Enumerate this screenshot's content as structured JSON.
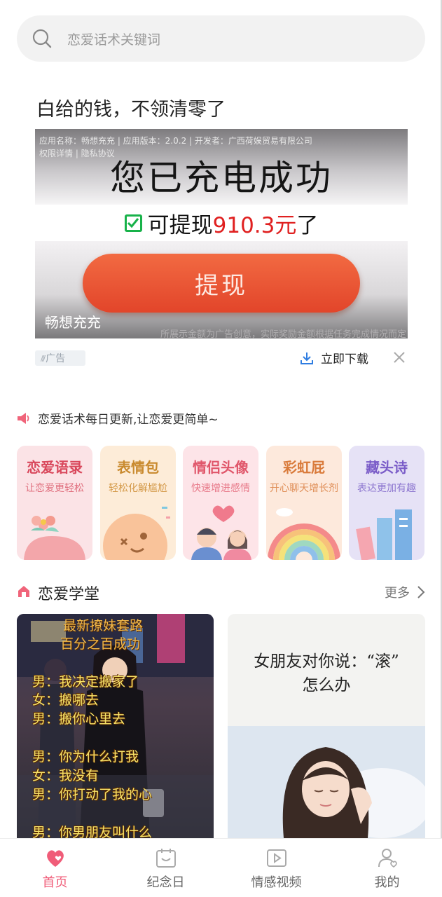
{
  "search": {
    "placeholder": "恋爱话术关键词"
  },
  "ad": {
    "title": "白给的钱，不领清零了",
    "meta_line1": "应用名称：畅想充充 | 应用版本：2.0.2 | 开发者：广西荷娱贸易有限公司",
    "meta_line2": "权限详情 | 隐私协议",
    "headline": "您已充电成功",
    "withdraw_prefix": "可提现",
    "withdraw_amount": "910.3元",
    "withdraw_suffix": "了",
    "button_label": "提现",
    "brand": "畅想充充",
    "disclaimer": "所展示金额为广告创意，实际奖励金额根据任务完成情况而定",
    "tag_label": "广告",
    "download_label": "立即下载"
  },
  "notice": {
    "text": "恋爱话术每日更新,让恋爱更简单~"
  },
  "categories": [
    {
      "title": "恋爱语录",
      "subtitle": "让恋爱更轻松",
      "bg": "#fbe3e6",
      "title_color": "#d9485c",
      "sub_color": "#e0707f"
    },
    {
      "title": "表情包",
      "subtitle": "轻松化解尴尬",
      "bg": "#fdecd8",
      "title_color": "#c98a2e",
      "sub_color": "#d49a4a"
    },
    {
      "title": "情侣头像",
      "subtitle": "快速增进感情",
      "bg": "#fde4e8",
      "title_color": "#e0566a",
      "sub_color": "#e87a8a"
    },
    {
      "title": "彩虹屁",
      "subtitle": "开心聊天增长剂",
      "bg": "#fde9dc",
      "title_color": "#d97a3a",
      "sub_color": "#e0905a"
    },
    {
      "title": "藏头诗",
      "subtitle": "表达更加有趣",
      "bg": "#e6e2f6",
      "title_color": "#7a5cc8",
      "sub_color": "#8e78d0"
    }
  ],
  "school": {
    "title": "恋爱学堂",
    "more_label": "更多"
  },
  "articles": {
    "left": {
      "heading1": "最新撩妹套路",
      "heading2": "百分之百成功",
      "lines": [
        "男：我决定搬家了",
        "女：搬哪去",
        "男：搬你心里去",
        "男：你为什么打我",
        "女：我没有",
        "男：你打动了我的心",
        "男：你男朋友叫什么"
      ]
    },
    "right": {
      "line1": "女朋友对你说：“滚”",
      "line2": "怎么办"
    }
  },
  "tabs": [
    {
      "label": "首页",
      "icon": "heart-home-icon",
      "active": true
    },
    {
      "label": "纪念日",
      "icon": "calendar-icon",
      "active": false
    },
    {
      "label": "情感视频",
      "icon": "video-icon",
      "active": false
    },
    {
      "label": "我的",
      "icon": "profile-icon",
      "active": false
    }
  ],
  "colors": {
    "accent": "#f05c78",
    "ad_button": "#e2452a",
    "amount_red": "#e02020",
    "check_green": "#18b24a"
  }
}
